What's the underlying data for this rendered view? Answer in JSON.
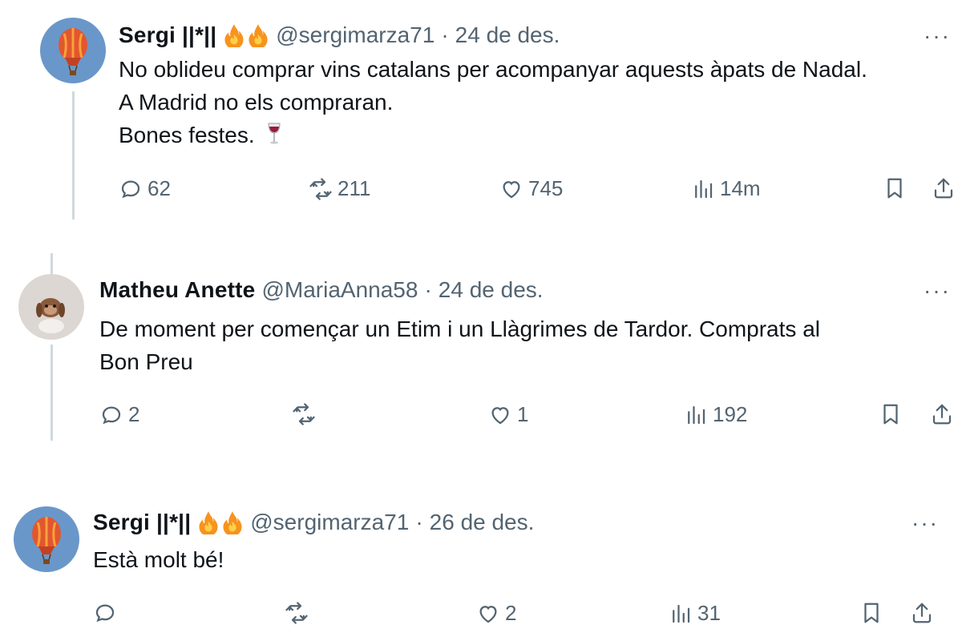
{
  "tweets": [
    {
      "name": "Sergi ||*||",
      "handle": "@sergimarza71",
      "separator": "·",
      "date": "24 de des.",
      "more": "···",
      "lines": [
        "No oblideu comprar vins catalans per acompanyar aquests àpats de Nadal.",
        "A Madrid no els compraran.",
        "Bones festes."
      ],
      "emoji": "wine-glass-icon",
      "stats": {
        "replies": "62",
        "retweets": "211",
        "likes": "745",
        "views": "14m"
      }
    },
    {
      "name": "Matheu Anette",
      "handle": "@MariaAnna58",
      "separator": "·",
      "date": "24 de des.",
      "more": "···",
      "lines": [
        "De moment per començar un Etim i un Llàgrimes de Tardor. Comprats al",
        "Bon Preu"
      ],
      "stats": {
        "replies": "2",
        "retweets": "",
        "likes": "1",
        "views": "192"
      }
    },
    {
      "name": "Sergi ||*||",
      "handle": "@sergimarza71",
      "separator": "·",
      "date": "26 de des.",
      "more": "···",
      "lines": [
        "Està molt bé!"
      ],
      "stats": {
        "replies": "",
        "retweets": "",
        "likes": "2",
        "views": "31"
      }
    }
  ],
  "colors": {
    "text": "#0f1419",
    "muted": "#536471",
    "thread_line": "#cfd9de",
    "flame": "#f7931e"
  }
}
